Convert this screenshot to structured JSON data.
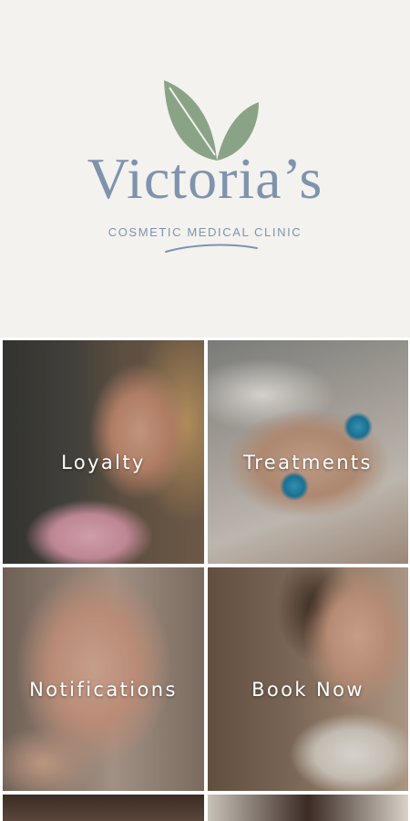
{
  "brand": {
    "name": "Victoria’s",
    "tagline": "COSMETIC MEDICAL CLINIC",
    "leaf_color": "#8aa387",
    "text_color": "#7f93ad"
  },
  "tiles": [
    {
      "id": "loyalty",
      "label": "Loyalty"
    },
    {
      "id": "treatments",
      "label": "Treatments"
    },
    {
      "id": "notifications",
      "label": "Notifications"
    },
    {
      "id": "booknow",
      "label": "Book Now"
    }
  ]
}
